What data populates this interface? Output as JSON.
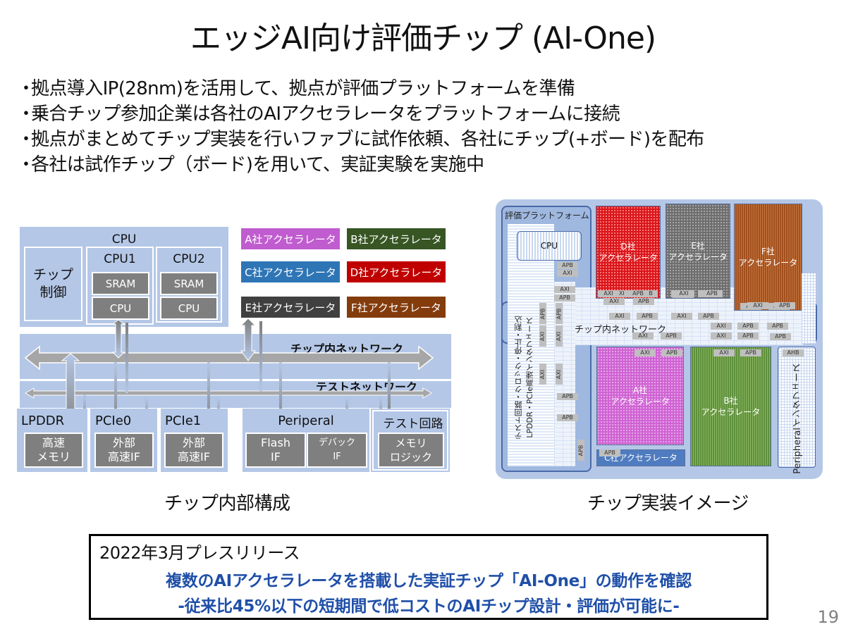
{
  "title": "エッジAI向け評価チップ (AI-One)",
  "bullets": [
    "拠点導入IP(28nm)を活用して、拠点が評価プラットフォームを準備",
    "乗合チップ参加企業は各社のAIアクセラレータをプラットフォームに接続",
    "拠点がまとめてチップ実装を行いファブに試作依頼、各社にチップ(+ボード)を配布",
    "各社は試作チップ（ボード)を用いて、実証実験を実施中"
  ],
  "bullet_marker": "・",
  "internal_diagram": {
    "caption": "チップ内部構成",
    "cpu_group_label": "CPU",
    "chip_control": "チップ\n制御",
    "cpu1": {
      "label": "CPU1",
      "sram": "SRAM",
      "cpu": "CPU"
    },
    "cpu2": {
      "label": "CPU2",
      "sram": "SRAM",
      "cpu": "CPU"
    },
    "accelerators": [
      {
        "label": "A社アクセラレータ",
        "color": "#c05ccf"
      },
      {
        "label": "B社アクセラレータ",
        "color": "#375623"
      },
      {
        "label": "C社アクセラレータ",
        "color": "#2e75b6"
      },
      {
        "label": "D社アクセラレータ",
        "color": "#c00000"
      },
      {
        "label": "E社アクセラレータ",
        "color": "#404040"
      },
      {
        "label": "F社アクセラレータ",
        "color": "#843c0c"
      }
    ],
    "chip_network": "チップ内ネットワーク",
    "test_network": "テストネットワーク",
    "lpddr": {
      "label": "LPDDR",
      "inner": "高速\nメモリ"
    },
    "pcie0": {
      "label": "PCIe0",
      "inner": "外部\n高速IF"
    },
    "pcie1": {
      "label": "PCIe1",
      "inner": "外部\n高速IF"
    },
    "peripheral": {
      "label": "Periperal",
      "flash": "Flash\nIF",
      "debug": "デバック\nIF"
    },
    "test_circuit": {
      "label": "テスト回路",
      "inner": "メモリ\nロジック"
    }
  },
  "floorplan": {
    "caption": "チップ実装イメージ",
    "platform_label": "評価プラットフォーム",
    "cpu": "CPU",
    "network": "チップ内ネットワーク",
    "left_vertical_1": "テスト回路・クロック・停止・割込",
    "left_vertical_2": "LPDDR・PCIe高速インタフェース",
    "right_vertical": "Peripheralインタフェース",
    "blocks": {
      "d": "D社\nアクセラレータ",
      "e": "E社\nアクセラレータ",
      "f": "F社\nアクセラレータ",
      "a": "A社\nアクセラレータ",
      "b": "B社\nアクセラレータ",
      "c": "C社アクセラレータ"
    },
    "bus_axi": "AXI",
    "bus_apb": "APB",
    "bus_ahb": "AHB"
  },
  "press_release": {
    "heading": "2022年3月プレスリリース",
    "line1": "複数のAIアクセラレータを搭載した実証チップ「AI-One」の動作を確認",
    "line2": "-従来比45%以下の短期間で低コストのAIチップ設計・評価が可能に-",
    "accent_color": "#1f4fa8"
  },
  "page_number": "19"
}
